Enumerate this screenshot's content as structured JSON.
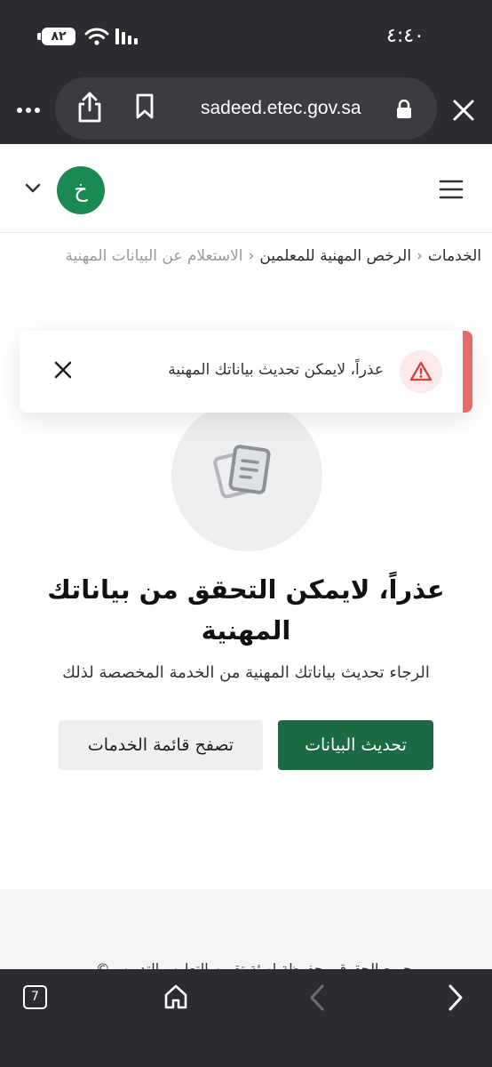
{
  "status_bar": {
    "time": "٤:٤٠",
    "battery": "٨٢"
  },
  "browser": {
    "url": "sadeed.etec.gov.sa",
    "tab_count": "7",
    "icons": [
      "more-icon",
      "share-icon",
      "bookmark-icon",
      "lock-icon",
      "close-icon",
      "home-icon",
      "back-icon",
      "forward-icon"
    ]
  },
  "header": {
    "avatar_initial": "خ"
  },
  "breadcrumb": {
    "items": [
      "الخدمات",
      "الرخص المهنية للمعلمين"
    ],
    "current": "الاستعلام عن البيانات المهنية"
  },
  "alert": {
    "message": "عذراً، لايمكن تحديث بياناتك المهنية"
  },
  "empty_state": {
    "title": "عذراً، لايمكن التحقق من بياناتك المهنية",
    "subtitle": "الرجاء تحديث بياناتك المهنية من الخدمة المخصصة لذلك",
    "primary_button": "تحديث البيانات",
    "secondary_button": "تصفح قائمة الخدمات"
  },
  "footer": {
    "partial_text": "جميع الحقوق محفوظة لهيئة تقويم التعليم والتدريب ©"
  },
  "colors": {
    "brand_green": "#1a6b44",
    "avatar_green": "#1a8a52",
    "alert_red": "#e36c66",
    "chrome_dark": "#2a2c30"
  }
}
